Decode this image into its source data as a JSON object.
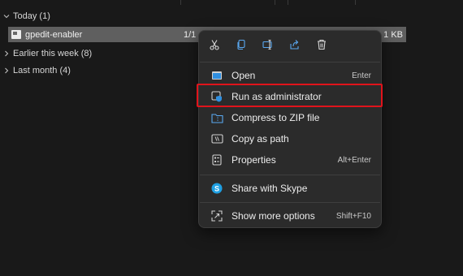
{
  "groups": [
    {
      "label": "Today (1)",
      "expanded": true
    },
    {
      "label": "Earlier this week (8)",
      "expanded": false
    },
    {
      "label": "Last month (4)",
      "expanded": false
    }
  ],
  "file": {
    "name": "gpedit-enabler",
    "date": "1/1",
    "size": "1 KB"
  },
  "context_menu": {
    "quick_actions": [
      {
        "icon": "cut-icon"
      },
      {
        "icon": "copy-icon"
      },
      {
        "icon": "rename-icon"
      },
      {
        "icon": "share-icon"
      },
      {
        "icon": "delete-icon"
      }
    ],
    "items": [
      {
        "label": "Open",
        "shortcut": "Enter",
        "icon": "open-icon"
      },
      {
        "label": "Run as administrator",
        "shortcut": "",
        "icon": "run-as-admin-icon"
      },
      {
        "label": "Compress to ZIP file",
        "shortcut": "",
        "icon": "zip-icon"
      },
      {
        "label": "Copy as path",
        "shortcut": "",
        "icon": "copy-path-icon"
      },
      {
        "label": "Properties",
        "shortcut": "Alt+Enter",
        "icon": "properties-icon"
      },
      {
        "label": "Share with Skype",
        "shortcut": "",
        "icon": "skype-icon"
      },
      {
        "label": "Show more options",
        "shortcut": "Shift+F10",
        "icon": "more-options-icon"
      }
    ]
  },
  "colors": {
    "highlight": "#e0131b",
    "skype": "#1fa0e3",
    "accent": "#2f8fe0"
  }
}
